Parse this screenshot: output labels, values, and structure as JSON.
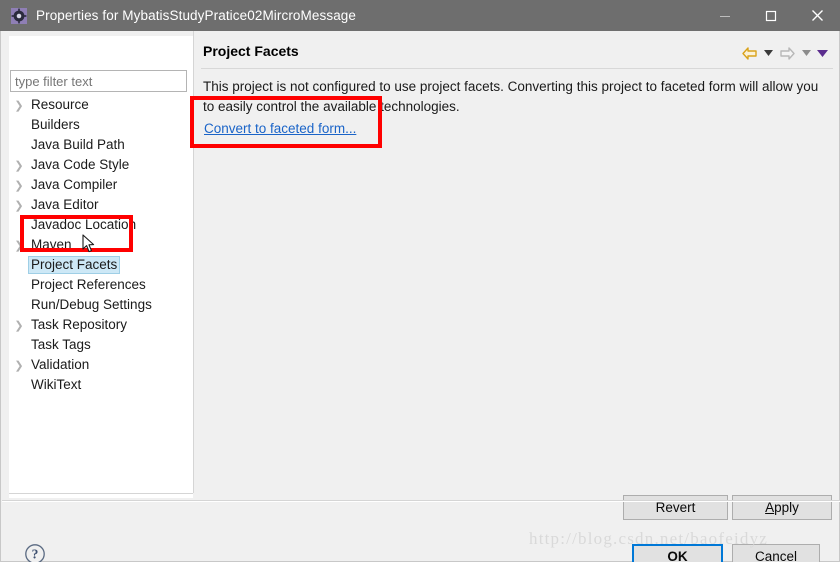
{
  "window": {
    "title": "Properties for MybatisStudyPratice02MircroMessage",
    "icon": "eclipse-properties-icon",
    "controls": {
      "minimize": "minimize-icon",
      "maximize": "maximize-icon",
      "close": "close-icon"
    },
    "titlebar_color": "#6e6e6e"
  },
  "filter": {
    "placeholder": "type filter text",
    "value": ""
  },
  "tree": {
    "items": [
      {
        "label": "Resource",
        "expandable": true,
        "selected": false
      },
      {
        "label": "Builders",
        "expandable": false,
        "selected": false
      },
      {
        "label": "Java Build Path",
        "expandable": false,
        "selected": false
      },
      {
        "label": "Java Code Style",
        "expandable": true,
        "selected": false
      },
      {
        "label": "Java Compiler",
        "expandable": true,
        "selected": false
      },
      {
        "label": "Java Editor",
        "expandable": true,
        "selected": false
      },
      {
        "label": "Javadoc Location",
        "expandable": false,
        "selected": false
      },
      {
        "label": "Maven",
        "expandable": true,
        "selected": false
      },
      {
        "label": "Project Facets",
        "expandable": false,
        "selected": true
      },
      {
        "label": "Project References",
        "expandable": false,
        "selected": false
      },
      {
        "label": "Run/Debug Settings",
        "expandable": false,
        "selected": false
      },
      {
        "label": "Task Repository",
        "expandable": true,
        "selected": false
      },
      {
        "label": "Task Tags",
        "expandable": false,
        "selected": false
      },
      {
        "label": "Validation",
        "expandable": true,
        "selected": false
      },
      {
        "label": "WikiText",
        "expandable": false,
        "selected": false
      }
    ]
  },
  "content": {
    "title": "Project Facets",
    "description": "This project is not configured to use project facets. Converting this project to faceted form will allow you to easily control the available technologies.",
    "link_label": "Convert to faceted form...",
    "link_color": "#1a64c8"
  },
  "nav_toolbar": {
    "back": "back-arrow-icon",
    "back_caret": "chevron-down-icon",
    "forward": "forward-arrow-icon",
    "forward_caret": "chevron-down-icon",
    "menu_caret": "chevron-down-filled-icon",
    "back_color": "#d9a21b",
    "forward_color": "#b8b8b8",
    "menu_color": "#5b2d8e"
  },
  "buttons": {
    "revert": "Revert",
    "apply_prefix": "",
    "apply_mnemonic": "A",
    "apply_suffix": "pply",
    "ok": "OK",
    "cancel": "Cancel",
    "help": "help-icon",
    "ok_focus_color": "#0078d7"
  },
  "annotations": [
    {
      "name": "convert-link-highlight",
      "color": "#ff0000"
    },
    {
      "name": "project-facets-highlight",
      "color": "#ff0000"
    }
  ],
  "watermark": {
    "text": "http://blog.csdn.net/baofeidyz"
  },
  "cursor": {
    "name": "mouse-pointer"
  }
}
